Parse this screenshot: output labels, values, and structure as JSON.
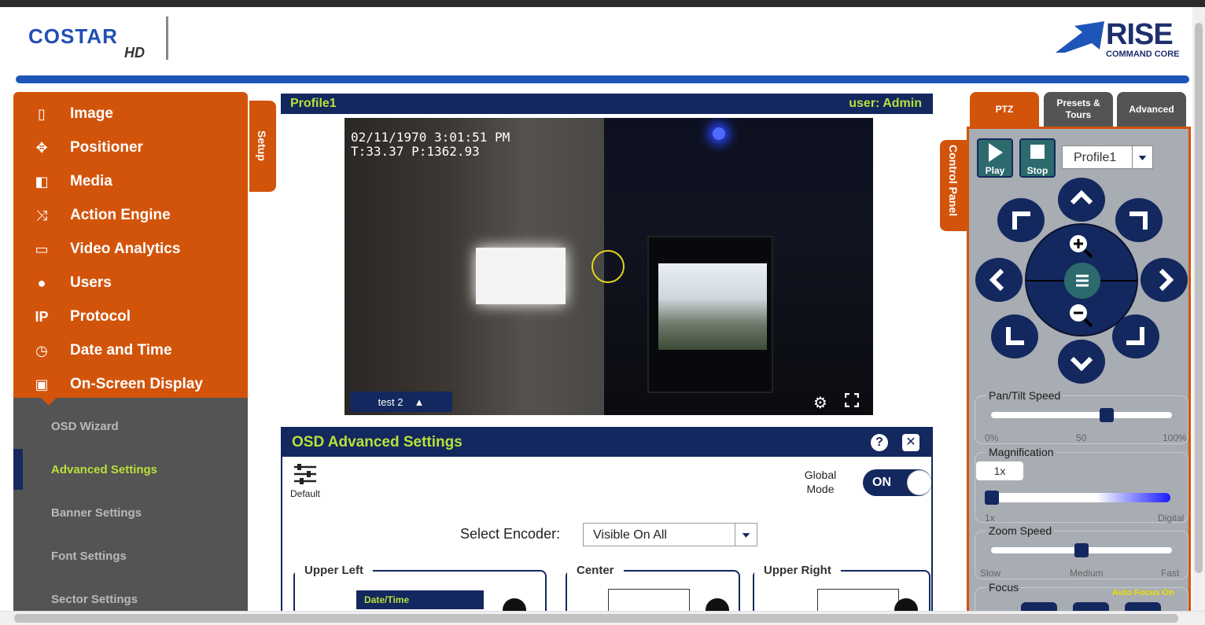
{
  "brand": {
    "costar": "COSTAR",
    "costar_hd": "HD",
    "rise": "RISE",
    "rise_sub": "COMMAND CORE"
  },
  "colors": {
    "orange": "#d2540b",
    "navy": "#13285e",
    "lime": "#b8e13a",
    "teal": "#2c6a6e"
  },
  "nav": {
    "items": [
      {
        "label": "Image",
        "icon": "tablet-icon"
      },
      {
        "label": "Positioner",
        "icon": "move-icon"
      },
      {
        "label": "Media",
        "icon": "media-icon"
      },
      {
        "label": "Action Engine",
        "icon": "shuffle-icon"
      },
      {
        "label": "Video Analytics",
        "icon": "monitor-chart-icon"
      },
      {
        "label": "Users",
        "icon": "user-icon"
      },
      {
        "label": "Protocol",
        "icon": "ip-icon"
      },
      {
        "label": "Date and Time",
        "icon": "clock-icon"
      },
      {
        "label": "On-Screen Display",
        "icon": "display-icon"
      }
    ],
    "sub": [
      {
        "label": "OSD Wizard"
      },
      {
        "label": "Advanced Settings",
        "active": true
      },
      {
        "label": "Banner Settings"
      },
      {
        "label": "Font Settings"
      },
      {
        "label": "Sector Settings"
      }
    ],
    "setup_tab": "Setup"
  },
  "video": {
    "profile": "Profile1",
    "user": "user: Admin",
    "osd_line1": "02/11/1970 3:01:51 PM",
    "osd_line2": "T:33.37 P:1362.93",
    "label": "test 2"
  },
  "osd_panel": {
    "title": "OSD Advanced Settings",
    "help": "?",
    "close": "✕",
    "default_label": "Default",
    "global_mode": "Global Mode",
    "toggle": "ON",
    "encoder_label": "Select Encoder:",
    "encoder_value": "Visible On All",
    "upper_left": "Upper Left",
    "center": "Center",
    "upper_right": "Upper Right",
    "date_time": "Date/Time"
  },
  "ptz": {
    "tabs": [
      {
        "label": "PTZ",
        "active": true
      },
      {
        "label": "Presets & Tours"
      },
      {
        "label": "Advanced"
      }
    ],
    "control_tab": "Control Panel",
    "play": "Play",
    "stop": "Stop",
    "profile": "Profile1",
    "pan_tilt": {
      "label": "Pan/Tilt Speed",
      "min": "0%",
      "mid": "50",
      "max": "100%",
      "value": 0.65
    },
    "magnification": {
      "label": "Magnification",
      "tip": "1x",
      "min": "1x",
      "max": "Digital",
      "value": 0.0
    },
    "zoom": {
      "label": "Zoom Speed",
      "min": "Slow",
      "mid": "Medium",
      "max": "Fast",
      "value": 0.5
    },
    "focus": {
      "label": "Focus",
      "auto": "Auto Focus On"
    }
  }
}
